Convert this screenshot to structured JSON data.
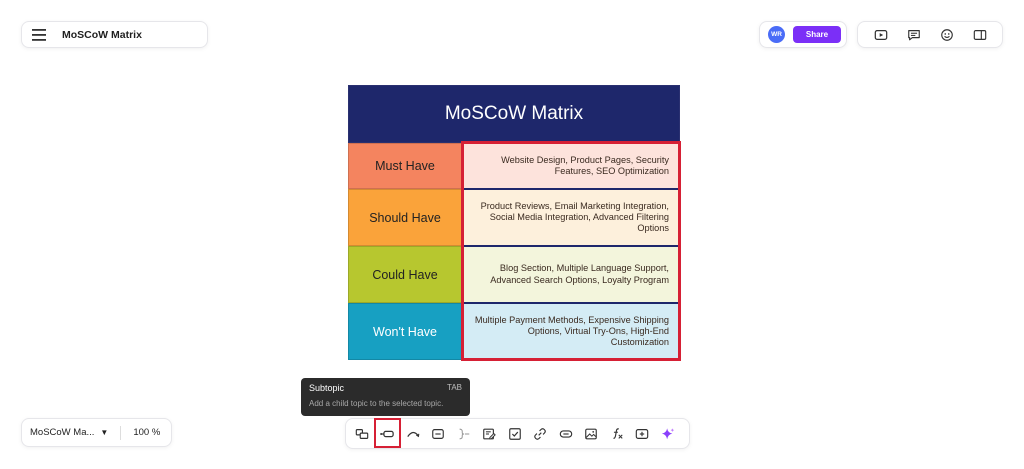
{
  "app": {
    "title": "MoSCoW Matrix",
    "menu_icon": "hamburger-menu-icon"
  },
  "share": {
    "avatar_initials": "WR",
    "avatar_color": "#4a6cf7",
    "button_label": "Share",
    "button_color": "#7b2ff7"
  },
  "right_toolbar": {
    "icons": [
      "slideshow-icon",
      "comment-icon",
      "emoji-icon",
      "sidebar-panel-icon"
    ]
  },
  "matrix": {
    "title": "MoSCoW Matrix",
    "header_color": "#1e276b",
    "rows": [
      {
        "label": "Must Have",
        "content": "Website Design,  Product Pages,   Security Features,  SEO Optimization",
        "color": "#f4845f"
      },
      {
        "label": "Should Have",
        "content": "Product Reviews, Email Marketing Integration, Social Media Integration, Advanced Filtering Options",
        "color": "#faa33a"
      },
      {
        "label": "Could Have",
        "content": "Blog Section, Multiple Language Support, Advanced Search Options, Loyalty Program",
        "color": "#b7c72f"
      },
      {
        "label": "Won't Have",
        "content": "Multiple Payment Methods, Expensive Shipping Options, Virtual Try-Ons, High-End Customization",
        "color": "#17a0c2"
      }
    ],
    "selection_color": "#d62035"
  },
  "tooltip": {
    "title": "Subtopic",
    "shortcut": "TAB",
    "description": "Add a child topic to the selected topic."
  },
  "file": {
    "name": "MoSCoW Ma...",
    "zoom": "100 %"
  },
  "bottom_toolbar": {
    "icons": [
      "topic-icon",
      "subtopic-icon",
      "relationship-icon",
      "boundary-icon",
      "summary-icon",
      "note-icon",
      "task-icon",
      "link-icon",
      "label-icon",
      "image-icon",
      "formula-icon",
      "insert-icon",
      "ai-sparkle-icon"
    ],
    "active": "subtopic-icon"
  }
}
